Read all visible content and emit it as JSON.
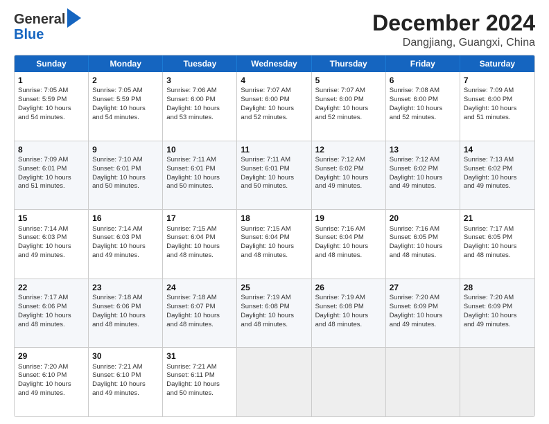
{
  "logo": {
    "line1": "General",
    "line2": "Blue"
  },
  "header": {
    "title": "December 2024",
    "subtitle": "Dangjiang, Guangxi, China"
  },
  "days": [
    "Sunday",
    "Monday",
    "Tuesday",
    "Wednesday",
    "Thursday",
    "Friday",
    "Saturday"
  ],
  "rows": [
    [
      {
        "day": "1",
        "data": "Sunrise: 7:05 AM\nSunset: 5:59 PM\nDaylight: 10 hours\nand 54 minutes."
      },
      {
        "day": "2",
        "data": "Sunrise: 7:05 AM\nSunset: 5:59 PM\nDaylight: 10 hours\nand 54 minutes."
      },
      {
        "day": "3",
        "data": "Sunrise: 7:06 AM\nSunset: 6:00 PM\nDaylight: 10 hours\nand 53 minutes."
      },
      {
        "day": "4",
        "data": "Sunrise: 7:07 AM\nSunset: 6:00 PM\nDaylight: 10 hours\nand 52 minutes."
      },
      {
        "day": "5",
        "data": "Sunrise: 7:07 AM\nSunset: 6:00 PM\nDaylight: 10 hours\nand 52 minutes."
      },
      {
        "day": "6",
        "data": "Sunrise: 7:08 AM\nSunset: 6:00 PM\nDaylight: 10 hours\nand 52 minutes."
      },
      {
        "day": "7",
        "data": "Sunrise: 7:09 AM\nSunset: 6:00 PM\nDaylight: 10 hours\nand 51 minutes."
      }
    ],
    [
      {
        "day": "8",
        "data": "Sunrise: 7:09 AM\nSunset: 6:01 PM\nDaylight: 10 hours\nand 51 minutes."
      },
      {
        "day": "9",
        "data": "Sunrise: 7:10 AM\nSunset: 6:01 PM\nDaylight: 10 hours\nand 50 minutes."
      },
      {
        "day": "10",
        "data": "Sunrise: 7:11 AM\nSunset: 6:01 PM\nDaylight: 10 hours\nand 50 minutes."
      },
      {
        "day": "11",
        "data": "Sunrise: 7:11 AM\nSunset: 6:01 PM\nDaylight: 10 hours\nand 50 minutes."
      },
      {
        "day": "12",
        "data": "Sunrise: 7:12 AM\nSunset: 6:02 PM\nDaylight: 10 hours\nand 49 minutes."
      },
      {
        "day": "13",
        "data": "Sunrise: 7:12 AM\nSunset: 6:02 PM\nDaylight: 10 hours\nand 49 minutes."
      },
      {
        "day": "14",
        "data": "Sunrise: 7:13 AM\nSunset: 6:02 PM\nDaylight: 10 hours\nand 49 minutes."
      }
    ],
    [
      {
        "day": "15",
        "data": "Sunrise: 7:14 AM\nSunset: 6:03 PM\nDaylight: 10 hours\nand 49 minutes."
      },
      {
        "day": "16",
        "data": "Sunrise: 7:14 AM\nSunset: 6:03 PM\nDaylight: 10 hours\nand 49 minutes."
      },
      {
        "day": "17",
        "data": "Sunrise: 7:15 AM\nSunset: 6:04 PM\nDaylight: 10 hours\nand 48 minutes."
      },
      {
        "day": "18",
        "data": "Sunrise: 7:15 AM\nSunset: 6:04 PM\nDaylight: 10 hours\nand 48 minutes."
      },
      {
        "day": "19",
        "data": "Sunrise: 7:16 AM\nSunset: 6:04 PM\nDaylight: 10 hours\nand 48 minutes."
      },
      {
        "day": "20",
        "data": "Sunrise: 7:16 AM\nSunset: 6:05 PM\nDaylight: 10 hours\nand 48 minutes."
      },
      {
        "day": "21",
        "data": "Sunrise: 7:17 AM\nSunset: 6:05 PM\nDaylight: 10 hours\nand 48 minutes."
      }
    ],
    [
      {
        "day": "22",
        "data": "Sunrise: 7:17 AM\nSunset: 6:06 PM\nDaylight: 10 hours\nand 48 minutes."
      },
      {
        "day": "23",
        "data": "Sunrise: 7:18 AM\nSunset: 6:06 PM\nDaylight: 10 hours\nand 48 minutes."
      },
      {
        "day": "24",
        "data": "Sunrise: 7:18 AM\nSunset: 6:07 PM\nDaylight: 10 hours\nand 48 minutes."
      },
      {
        "day": "25",
        "data": "Sunrise: 7:19 AM\nSunset: 6:08 PM\nDaylight: 10 hours\nand 48 minutes."
      },
      {
        "day": "26",
        "data": "Sunrise: 7:19 AM\nSunset: 6:08 PM\nDaylight: 10 hours\nand 48 minutes."
      },
      {
        "day": "27",
        "data": "Sunrise: 7:20 AM\nSunset: 6:09 PM\nDaylight: 10 hours\nand 49 minutes."
      },
      {
        "day": "28",
        "data": "Sunrise: 7:20 AM\nSunset: 6:09 PM\nDaylight: 10 hours\nand 49 minutes."
      }
    ],
    [
      {
        "day": "29",
        "data": "Sunrise: 7:20 AM\nSunset: 6:10 PM\nDaylight: 10 hours\nand 49 minutes."
      },
      {
        "day": "30",
        "data": "Sunrise: 7:21 AM\nSunset: 6:10 PM\nDaylight: 10 hours\nand 49 minutes."
      },
      {
        "day": "31",
        "data": "Sunrise: 7:21 AM\nSunset: 6:11 PM\nDaylight: 10 hours\nand 50 minutes."
      },
      {
        "day": "",
        "data": ""
      },
      {
        "day": "",
        "data": ""
      },
      {
        "day": "",
        "data": ""
      },
      {
        "day": "",
        "data": ""
      }
    ]
  ]
}
